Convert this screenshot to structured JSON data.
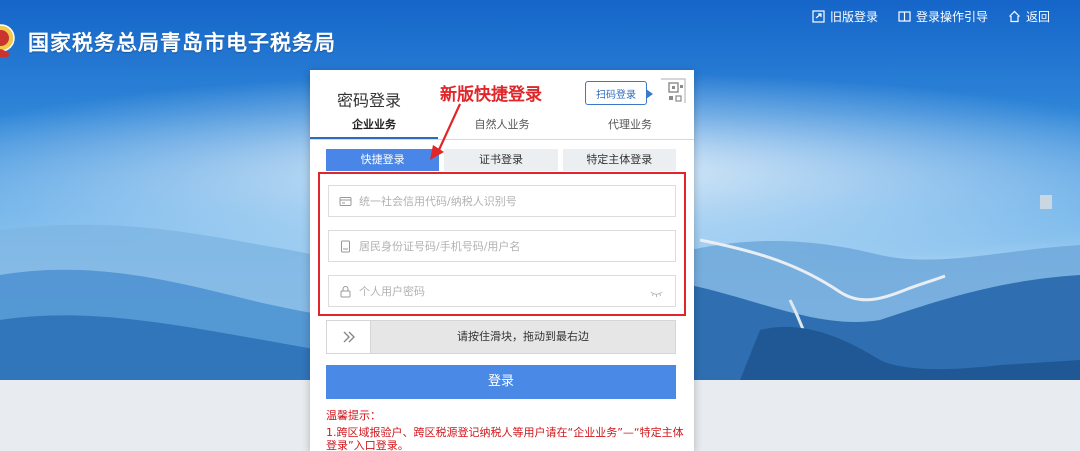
{
  "header": {
    "title": "国家税务总局青岛市电子税务局",
    "links": [
      {
        "label": "旧版登录",
        "icon": "old-login-icon"
      },
      {
        "label": "登录操作引导",
        "icon": "guide-icon"
      },
      {
        "label": "返回",
        "icon": "home-icon"
      }
    ]
  },
  "login": {
    "title": "密码登录",
    "qr_label": "扫码登录",
    "tabs": [
      {
        "label": "企业业务",
        "active": true
      },
      {
        "label": "自然人业务",
        "active": false
      },
      {
        "label": "代理业务",
        "active": false
      }
    ],
    "subtabs": [
      {
        "label": "快捷登录",
        "active": true
      },
      {
        "label": "证书登录",
        "active": false
      },
      {
        "label": "特定主体登录",
        "active": false
      }
    ],
    "fields": {
      "credit_code_placeholder": "统一社会信用代码/纳税人识别号",
      "account_placeholder": "居民身份证号码/手机号码/用户名",
      "password_placeholder": "个人用户密码"
    },
    "slider_text": "请按住滑块，拖动到最右边",
    "submit_label": "登录",
    "tips_title": "温馨提示：",
    "tips_line": "1.跨区域报验户、跨区税源登记纳税人等用户请在“企业业务”—“特定主体登录”入口登录。"
  },
  "annotation": {
    "text": "新版快捷登录"
  },
  "colors": {
    "primary": "#4b89e6",
    "annotation": "#e0262a",
    "tip": "#d0161b"
  }
}
